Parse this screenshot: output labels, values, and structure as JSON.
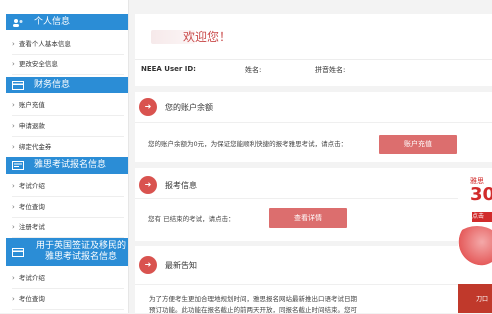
{
  "sidebar": {
    "sections": [
      {
        "title": "个人信息",
        "icon": "user-icon",
        "items": [
          "查看个人基本信息",
          "更改安全信息"
        ]
      },
      {
        "title": "财务信息",
        "icon": "finance-icon",
        "items": [
          "账户充值",
          "申请退款",
          "绑定代金券"
        ]
      },
      {
        "title": "雅思考试报名信息",
        "icon": "exam-icon",
        "items": [
          "考试介绍",
          "考位查询",
          "注册考试"
        ]
      },
      {
        "title": "用于英国签证及移民的雅思考试报名信息",
        "icon": "visa-icon",
        "items": [
          "考试介绍",
          "考位查询"
        ]
      }
    ]
  },
  "welcome": {
    "greeting": "欢迎您！",
    "neea_label": "NEEA User ID:",
    "name_label": "姓名:",
    "pinyin_label": "拼音姓名:"
  },
  "balance": {
    "title": "您的账户余额",
    "text": "您的账户余额为0元，为保证您能顺利快捷的报考雅思考试，请点击：",
    "button": "账户充值"
  },
  "registration": {
    "title": "报考信息",
    "text": "您有    已结束的考试，请点击：",
    "button": "查看详情"
  },
  "notice": {
    "title": "最新告知",
    "line1": "为了方便考生更加合理地规划时间，雅思报名网站最新推出口语考试日期",
    "line2": "预订功能。此功能在报名截止的前两天开放，同报名截止时间结束。您可"
  },
  "banner": {
    "line1": "雅思",
    "line2": "30",
    "line3": "点击",
    "bottom": "刀口"
  },
  "colors": {
    "accent_blue": "#2b8dd6",
    "button_red": "#dc6e6e",
    "icon_red": "#d9534f",
    "greeting_red": "#c94a4a"
  }
}
